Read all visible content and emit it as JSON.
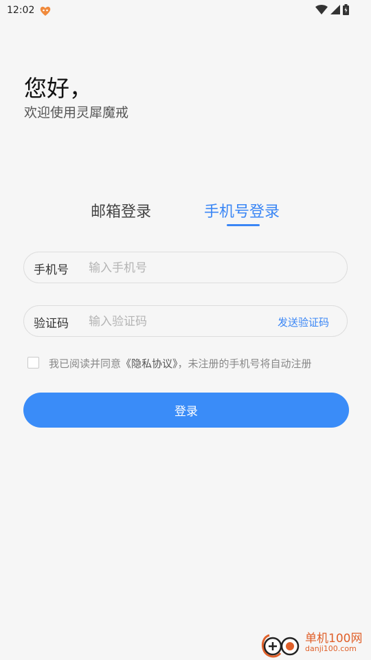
{
  "status_bar": {
    "time": "12:02",
    "icons": [
      "app-notification-icon",
      "wifi-icon",
      "signal-icon",
      "battery-icon"
    ]
  },
  "header": {
    "greeting": "您好，",
    "subtitle": "欢迎使用灵犀魔戒"
  },
  "tabs": [
    {
      "label": "邮箱登录",
      "active": false
    },
    {
      "label": "手机号登录",
      "active": true
    }
  ],
  "form": {
    "phone_label": "手机号",
    "phone_placeholder": "输入手机号",
    "phone_value": "",
    "code_label": "验证码",
    "code_placeholder": "输入验证码",
    "code_value": "",
    "send_code_label": "发送验证码"
  },
  "agreement": {
    "checked": false,
    "prefix": "我已阅读并同意",
    "link": "《隐私协议》",
    "suffix": "，未注册的手机号将自动注册"
  },
  "login_button_label": "登录",
  "watermark": {
    "title": "单机100网",
    "domain": "danji100.com"
  },
  "colors": {
    "accent": "#3a86f5",
    "button": "#3a8cf8",
    "background": "#f6f6f6",
    "watermark": "#e0602a"
  }
}
